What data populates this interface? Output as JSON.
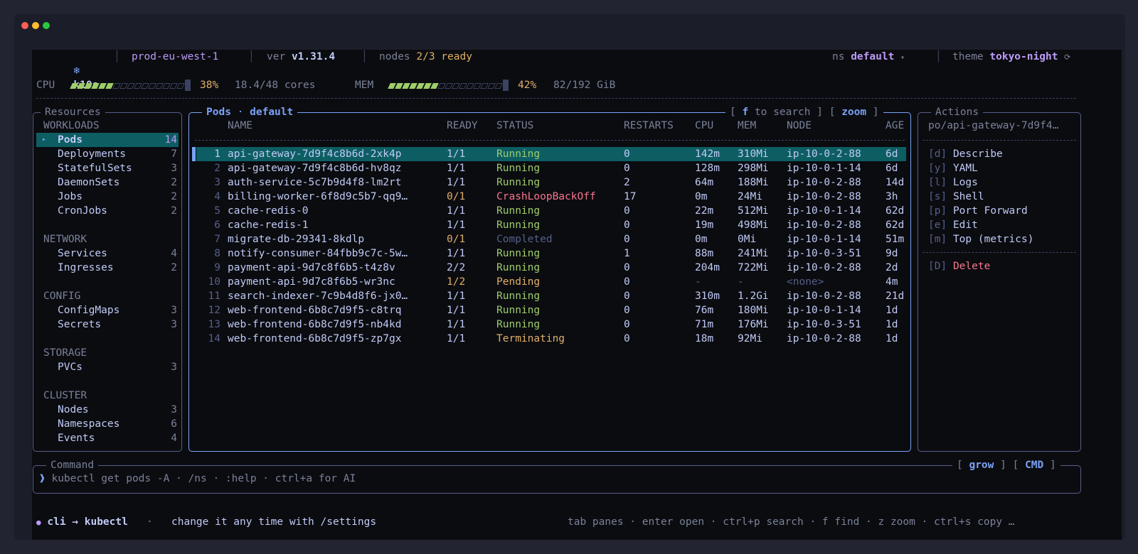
{
  "header": {
    "app_name": "k10s",
    "context": "prod-eu-west-1",
    "ver_label": "ver",
    "version": "v1.31.4",
    "nodes_label": "nodes",
    "nodes_ready": "2/3 ready",
    "ns_label": "ns",
    "ns_value": "default",
    "ns_caret": "▾",
    "theme_label": "theme",
    "theme_value": "tokyo-night",
    "theme_icon": "⟳"
  },
  "metrics": {
    "cpu_label": "CPU",
    "cpu_percent_text": "38%",
    "cpu_percent": 0.38,
    "cpu_detail": "18.4/48 cores",
    "mem_label": "MEM",
    "mem_percent_text": "42%",
    "mem_percent": 0.42,
    "mem_detail": "82/192 GiB"
  },
  "resources": {
    "title": "Resources",
    "groups": [
      {
        "name": "WORKLOADS",
        "items": [
          {
            "label": "Pods",
            "count": "14",
            "selected": true,
            "marker": "▸"
          },
          {
            "label": "Deployments",
            "count": "7"
          },
          {
            "label": "StatefulSets",
            "count": "3"
          },
          {
            "label": "DaemonSets",
            "count": "2"
          },
          {
            "label": "Jobs",
            "count": "2"
          },
          {
            "label": "CronJobs",
            "count": "2"
          }
        ]
      },
      {
        "name": "NETWORK",
        "items": [
          {
            "label": "Services",
            "count": "4"
          },
          {
            "label": "Ingresses",
            "count": "2"
          }
        ]
      },
      {
        "name": "CONFIG",
        "items": [
          {
            "label": "ConfigMaps",
            "count": "3"
          },
          {
            "label": "Secrets",
            "count": "3"
          }
        ]
      },
      {
        "name": "STORAGE",
        "items": [
          {
            "label": "PVCs",
            "count": "3"
          }
        ]
      },
      {
        "name": "CLUSTER",
        "items": [
          {
            "label": "Nodes",
            "count": "3"
          },
          {
            "label": "Namespaces",
            "count": "6"
          },
          {
            "label": "Events",
            "count": "4"
          }
        ]
      }
    ]
  },
  "pods_panel": {
    "title_left": "Pods",
    "title_dot": "·",
    "title_ns": "default",
    "search_hint_open": "[",
    "search_key": "f",
    "search_text": "to search",
    "search_hint_close": "]",
    "zoom_open": "[",
    "zoom_text": "zoom",
    "zoom_close": "]",
    "columns": [
      "NAME",
      "READY",
      "STATUS",
      "RESTARTS",
      "CPU",
      "MEM",
      "NODE",
      "AGE"
    ],
    "rows": [
      {
        "n": "1",
        "name": "api-gateway-7d9f4c8b6d-2xk4p",
        "ready": "1/1",
        "status": "Running",
        "restarts": "0",
        "cpu": "142m",
        "mem": "310Mi",
        "node": "ip-10-0-2-88",
        "age": "6d",
        "selected": true
      },
      {
        "n": "2",
        "name": "api-gateway-7d9f4c8b6d-hv8qz",
        "ready": "1/1",
        "status": "Running",
        "restarts": "0",
        "cpu": "128m",
        "mem": "298Mi",
        "node": "ip-10-0-1-14",
        "age": "6d"
      },
      {
        "n": "3",
        "name": "auth-service-5c7b9d4f8-lm2rt",
        "ready": "1/1",
        "status": "Running",
        "restarts": "2",
        "cpu": "64m",
        "mem": "188Mi",
        "node": "ip-10-0-2-88",
        "age": "14d"
      },
      {
        "n": "4",
        "name": "billing-worker-6f8d9c5b7-qq9…",
        "ready": "0/1",
        "status": "CrashLoopBackOff",
        "restarts": "17",
        "cpu": "0m",
        "mem": "24Mi",
        "node": "ip-10-0-2-88",
        "age": "3h"
      },
      {
        "n": "5",
        "name": "cache-redis-0",
        "ready": "1/1",
        "status": "Running",
        "restarts": "0",
        "cpu": "22m",
        "mem": "512Mi",
        "node": "ip-10-0-1-14",
        "age": "62d"
      },
      {
        "n": "6",
        "name": "cache-redis-1",
        "ready": "1/1",
        "status": "Running",
        "restarts": "0",
        "cpu": "19m",
        "mem": "498Mi",
        "node": "ip-10-0-2-88",
        "age": "62d"
      },
      {
        "n": "7",
        "name": "migrate-db-29341-8kdlp",
        "ready": "0/1",
        "status": "Completed",
        "restarts": "0",
        "cpu": "0m",
        "mem": "0Mi",
        "node": "ip-10-0-1-14",
        "age": "51m"
      },
      {
        "n": "8",
        "name": "notify-consumer-84fbb9c7c-5w…",
        "ready": "1/1",
        "status": "Running",
        "restarts": "1",
        "cpu": "88m",
        "mem": "241Mi",
        "node": "ip-10-0-3-51",
        "age": "9d"
      },
      {
        "n": "9",
        "name": "payment-api-9d7c8f6b5-t4z8v",
        "ready": "2/2",
        "status": "Running",
        "restarts": "0",
        "cpu": "204m",
        "mem": "722Mi",
        "node": "ip-10-0-2-88",
        "age": "2d"
      },
      {
        "n": "10",
        "name": "payment-api-9d7c8f6b5-wr3nc",
        "ready": "1/2",
        "status": "Pending",
        "restarts": "0",
        "cpu": "-",
        "mem": "-",
        "node": "<none>",
        "age": "4m"
      },
      {
        "n": "11",
        "name": "search-indexer-7c9b4d8f6-jx0…",
        "ready": "1/1",
        "status": "Running",
        "restarts": "0",
        "cpu": "310m",
        "mem": "1.2Gi",
        "node": "ip-10-0-2-88",
        "age": "21d"
      },
      {
        "n": "12",
        "name": "web-frontend-6b8c7d9f5-c8trq",
        "ready": "1/1",
        "status": "Running",
        "restarts": "0",
        "cpu": "76m",
        "mem": "180Mi",
        "node": "ip-10-0-1-14",
        "age": "1d"
      },
      {
        "n": "13",
        "name": "web-frontend-6b8c7d9f5-nb4kd",
        "ready": "1/1",
        "status": "Running",
        "restarts": "0",
        "cpu": "71m",
        "mem": "176Mi",
        "node": "ip-10-0-3-51",
        "age": "1d"
      },
      {
        "n": "14",
        "name": "web-frontend-6b8c7d9f5-zp7gx",
        "ready": "1/1",
        "status": "Terminating",
        "restarts": "0",
        "cpu": "18m",
        "mem": "92Mi",
        "node": "ip-10-0-2-88",
        "age": "1d"
      }
    ]
  },
  "actions": {
    "title": "Actions",
    "target": "po/api-gateway-7d9f4…",
    "items": [
      {
        "key": "[d]",
        "label": "Describe"
      },
      {
        "key": "[y]",
        "label": "YAML"
      },
      {
        "key": "[l]",
        "label": "Logs"
      },
      {
        "key": "[s]",
        "label": "Shell"
      },
      {
        "key": "[p]",
        "label": "Port Forward"
      },
      {
        "key": "[e]",
        "label": "Edit"
      },
      {
        "key": "[m]",
        "label": "Top (metrics)"
      }
    ],
    "danger": {
      "key": "[D]",
      "label": "Delete"
    }
  },
  "command": {
    "title": "Command",
    "grow_open": "[",
    "grow": "grow",
    "grow_close": "]",
    "cmd_open": "[",
    "cmd": "CMD",
    "cmd_close": "]",
    "prompt": "❱",
    "placeholder": "kubectl get pods -A · /ns · :help · ctrl+a for AI"
  },
  "statusbar": {
    "mode_dot": "●",
    "mode": "cli → kubectl",
    "bullet": "·",
    "hint": "change it any time with /settings",
    "shortcuts": "tab panes · enter open · ctrl+p search · f find · z zoom · ctrl+s copy …"
  },
  "colors": {
    "accent": "#bb9af7",
    "blue": "#7aa2f7",
    "running": "#9ece6a",
    "warning": "#e0af68",
    "error": "#f7768e",
    "selection": "#0d5e63"
  }
}
